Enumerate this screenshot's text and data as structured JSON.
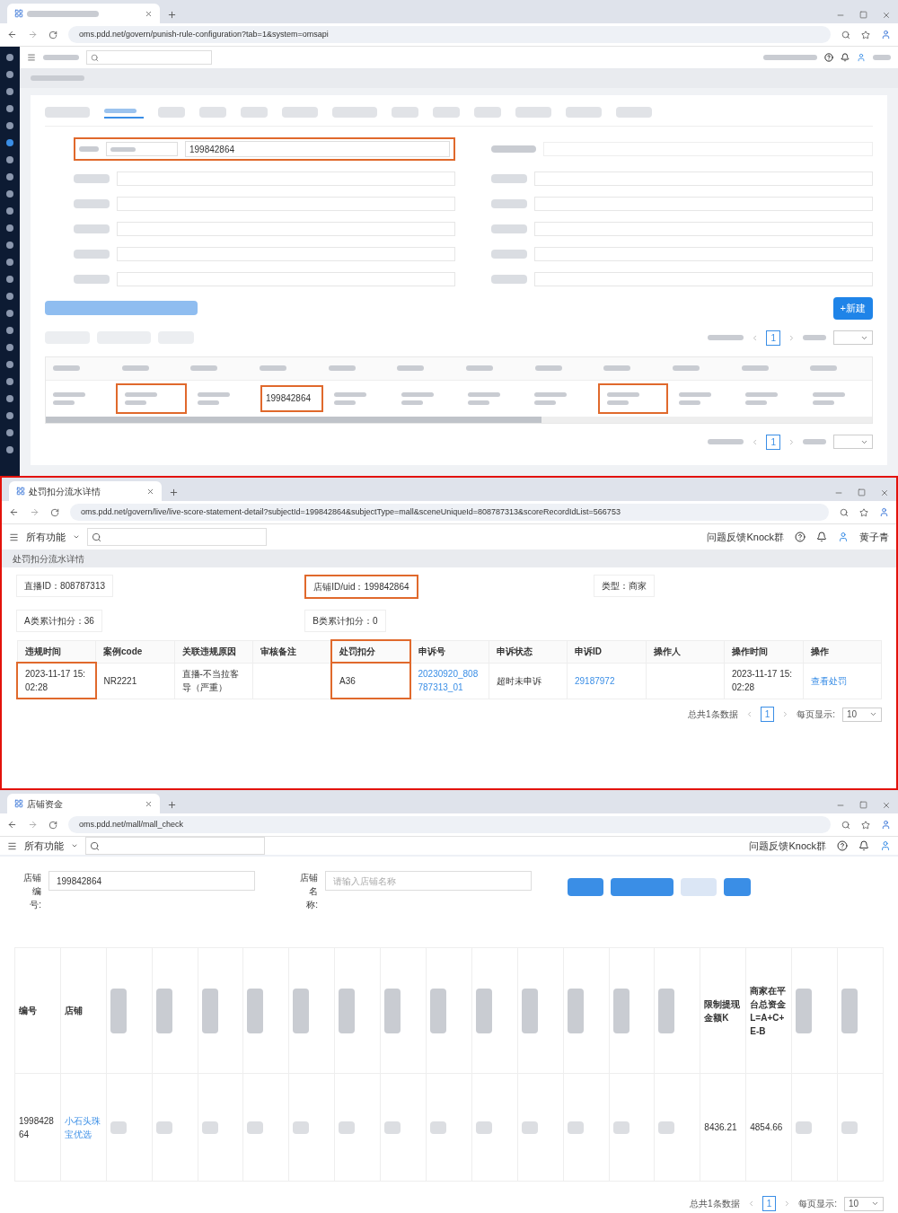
{
  "rule_config_window": {
    "url": "oms.pdd.net/govern/punish-rule-configuration?tab=1&system=omsapi",
    "mall_id_filter": {
      "value": "199842864",
      "highlighted": true
    },
    "create_button": {
      "label": "+新建"
    },
    "pagination_top": {
      "page": "1"
    },
    "table_row": {
      "mall_id": "199842864",
      "highlighted": true
    },
    "pagination_bottom": {
      "page": "1"
    }
  },
  "score_detail_window": {
    "tab_title": "处罚扣分流水详情",
    "url": "oms.pdd.net/govern/live/live-score-statement-detail?subjectId=199842864&subjectType=mall&sceneUniqueId=808787313&scoreRecordIdList=566753",
    "menu_label": "所有功能",
    "feedback_link": "问题反馈Knock群",
    "user_name": "黄子青",
    "breadcrumb": "处罚扣分流水详情",
    "fields": [
      {
        "text": "直播ID：808787313",
        "highlighted": false
      },
      {
        "text": "店铺ID/uid：199842864",
        "highlighted": true
      },
      {
        "text": "类型：商家",
        "highlighted": false
      },
      {
        "text": "A类累计扣分：36",
        "highlighted": false
      },
      {
        "text": "B类累计扣分：0",
        "highlighted": false
      }
    ],
    "columns": [
      {
        "label": "违规时间",
        "highlighted": false
      },
      {
        "label": "案例code",
        "highlighted": false
      },
      {
        "label": "关联违规原因",
        "highlighted": false
      },
      {
        "label": "审核备注",
        "highlighted": false
      },
      {
        "label": "处罚扣分",
        "highlighted": true
      },
      {
        "label": "申诉号",
        "highlighted": false
      },
      {
        "label": "申诉状态",
        "highlighted": false
      },
      {
        "label": "申诉ID",
        "highlighted": false
      },
      {
        "label": "操作人",
        "highlighted": false
      },
      {
        "label": "操作时间",
        "highlighted": false
      },
      {
        "label": "操作",
        "highlighted": false
      }
    ],
    "rows": [
      [
        {
          "kind": "text",
          "text": "2023-11-17 15:02:28",
          "highlighted": true
        },
        {
          "kind": "text",
          "text": "NR2221",
          "highlighted": false
        },
        {
          "kind": "text",
          "text": "直播-不当拉客导（严重）",
          "highlighted": false
        },
        {
          "kind": "empty",
          "highlighted": false
        },
        {
          "kind": "text",
          "text": "A36",
          "highlighted": true
        },
        {
          "kind": "link",
          "text": "20230920_808787313_01",
          "highlighted": false
        },
        {
          "kind": "text",
          "text": "超时未申诉",
          "highlighted": false
        },
        {
          "kind": "link",
          "text": "29187972",
          "highlighted": false
        },
        {
          "kind": "empty",
          "highlighted": false
        },
        {
          "kind": "text",
          "text": "2023-11-17 15:02:28",
          "highlighted": false
        },
        {
          "kind": "link",
          "text": "查看处罚",
          "highlighted": false
        }
      ]
    ],
    "pagination": {
      "total": "总共1条数据",
      "page": "1",
      "page_size_label": "每页显示:",
      "page_size": "10"
    }
  },
  "mall_funds_window": {
    "tab_title": "店铺资金",
    "url": "oms.pdd.net/mall/mall_check",
    "menu_label": "所有功能",
    "feedback_link": "问题反馈Knock群",
    "filters": [
      {
        "label": "店铺编号:",
        "value": "199842864"
      },
      {
        "label": "店铺名称:",
        "placeholder": "请输入店铺名称"
      }
    ],
    "columns": [
      {
        "kind": "text",
        "label": "编号"
      },
      {
        "kind": "text",
        "label": "店铺"
      },
      {
        "kind": "redacted"
      },
      {
        "kind": "redacted"
      },
      {
        "kind": "redacted"
      },
      {
        "kind": "redacted"
      },
      {
        "kind": "redacted"
      },
      {
        "kind": "redacted"
      },
      {
        "kind": "redacted"
      },
      {
        "kind": "redacted"
      },
      {
        "kind": "redacted"
      },
      {
        "kind": "redacted"
      },
      {
        "kind": "redacted"
      },
      {
        "kind": "redacted"
      },
      {
        "kind": "redacted"
      },
      {
        "kind": "text",
        "label": "限制提现金额K"
      },
      {
        "kind": "text",
        "label": "商家在平台总资金L=A+C+E-B"
      },
      {
        "kind": "redacted"
      },
      {
        "kind": "redacted"
      }
    ],
    "rows": [
      [
        {
          "kind": "text",
          "text": "199842864"
        },
        {
          "kind": "link",
          "text": "小石头珠宝优选"
        },
        {
          "kind": "redacted"
        },
        {
          "kind": "redacted"
        },
        {
          "kind": "redacted"
        },
        {
          "kind": "redacted"
        },
        {
          "kind": "redacted"
        },
        {
          "kind": "redacted"
        },
        {
          "kind": "redacted"
        },
        {
          "kind": "redacted"
        },
        {
          "kind": "redacted"
        },
        {
          "kind": "redacted"
        },
        {
          "kind": "redacted"
        },
        {
          "kind": "redacted"
        },
        {
          "kind": "redacted"
        },
        {
          "kind": "text",
          "text": "8436.21"
        },
        {
          "kind": "text",
          "text": "4854.66"
        },
        {
          "kind": "redacted"
        },
        {
          "kind": "redacted"
        }
      ]
    ],
    "pagination": {
      "total": "总共1条数据",
      "page": "1",
      "page_size_label": "每页显示:",
      "page_size": "10"
    }
  }
}
